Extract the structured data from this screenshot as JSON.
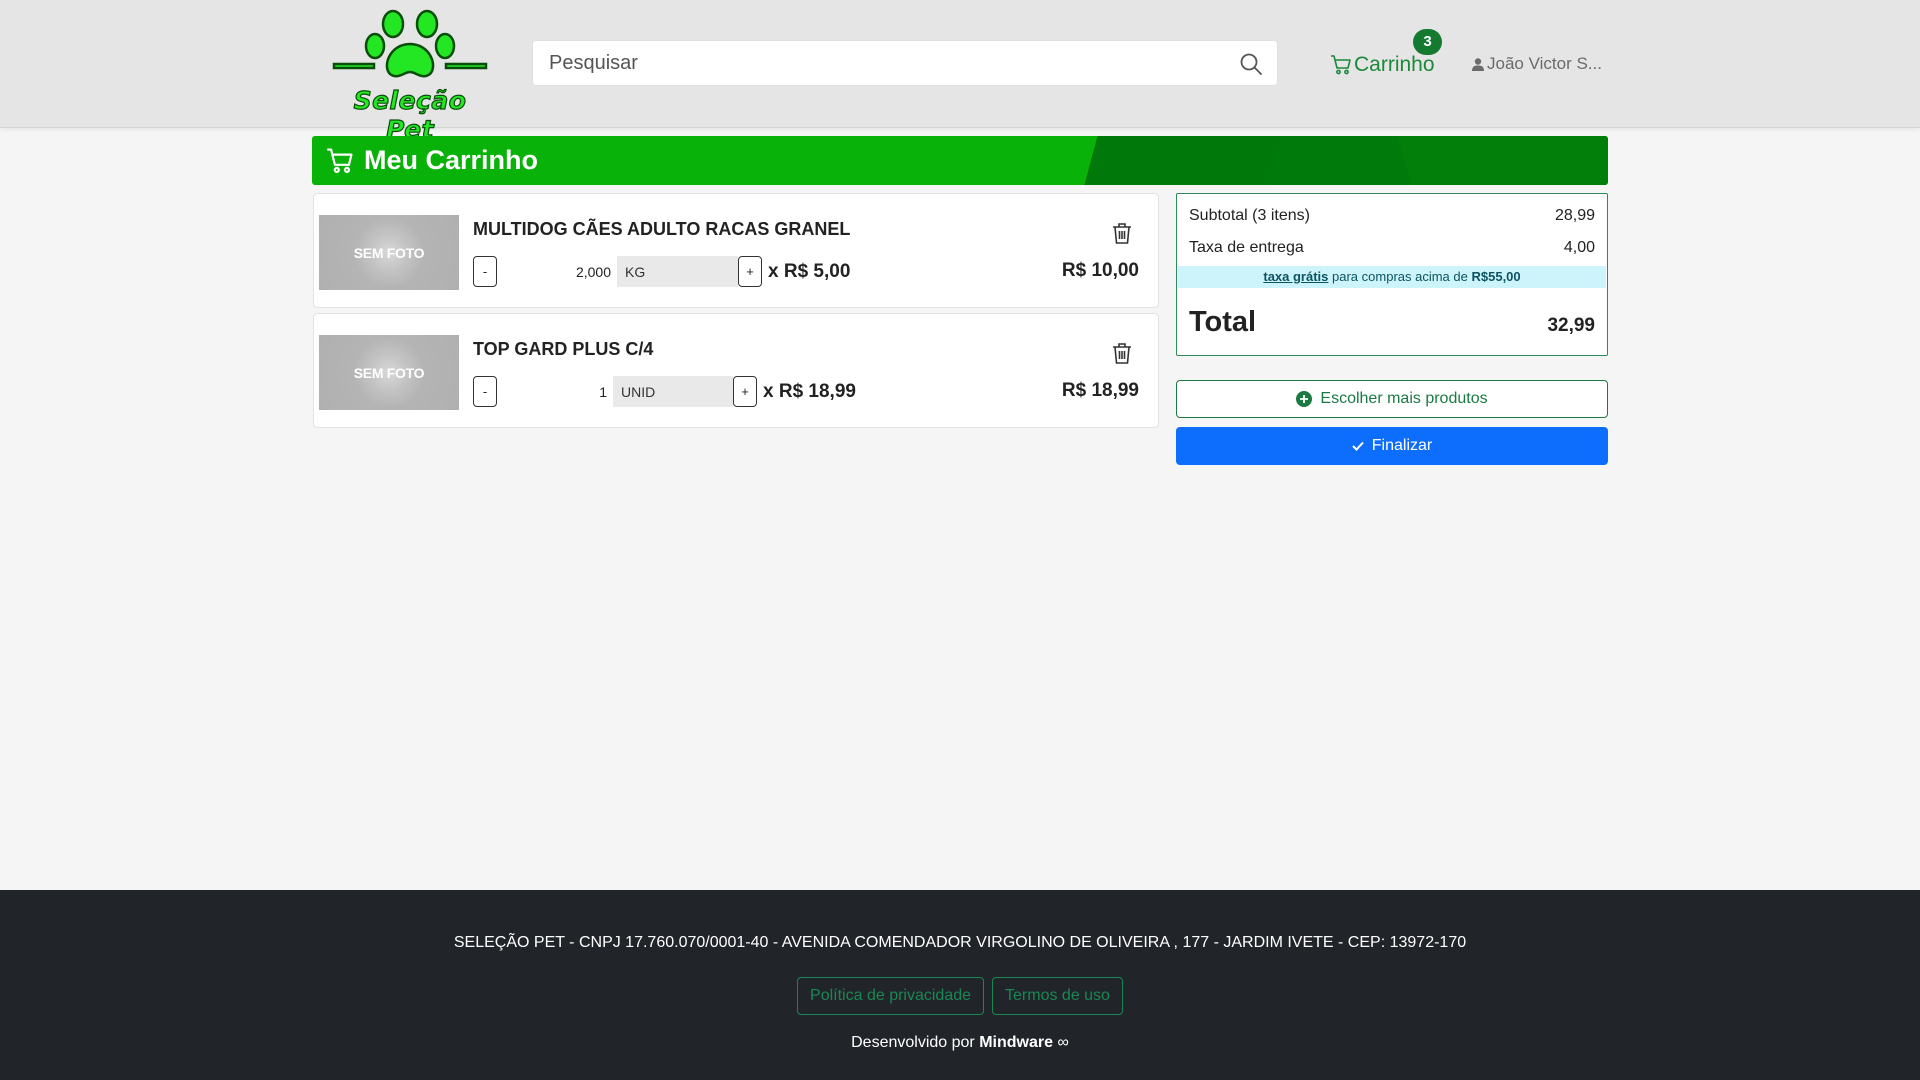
{
  "header": {
    "logo_text": "Seleção Pet",
    "search": {
      "placeholder": "Pesquisar",
      "value": ""
    },
    "cart": {
      "label": "Carrinho",
      "count": "3"
    },
    "user": {
      "name": "João Victor S..."
    }
  },
  "page_title": "Meu Carrinho",
  "items": [
    {
      "photo_label": "SEM FOTO",
      "name": "MULTIDOG CÃES ADULTO RACAS GRANEL",
      "minus": "-",
      "quantity": "2,000",
      "unit": "KG",
      "plus": "+",
      "unit_price": "x R$ 5,00",
      "total": "R$ 10,00"
    },
    {
      "photo_label": "SEM FOTO",
      "name": "TOP GARD PLUS C/4",
      "minus": "-",
      "quantity": "1",
      "unit": "UNID",
      "plus": "+",
      "unit_price": "x R$ 18,99",
      "total": "R$ 18,99"
    }
  ],
  "summary": {
    "subtotal_label": "Subtotal (3 itens)",
    "subtotal_value": "28,99",
    "delivery_label": "Taxa de entrega",
    "delivery_value": "4,00",
    "free_link": "taxa grátis",
    "free_text": " para compras acima de ",
    "free_amount": "R$55,00",
    "total_label": "Total",
    "total_value": "32,99"
  },
  "actions": {
    "more_label": "Escolher mais produtos",
    "finish_label": "Finalizar"
  },
  "footer": {
    "address": "SELEÇÃO PET - CNPJ 17.760.070/0001-40 - AVENIDA COMENDADOR VIRGOLINO DE OLIVEIRA , 177 - JARDIM IVETE - CEP: 13972-170",
    "privacy": "Política de privacidade",
    "terms": "Termos de uso",
    "dev_prefix": "Desenvolvido por ",
    "dev_brand": "Mindware",
    "dev_symbol": "∞"
  },
  "colors": {
    "brand_green": "#08b208",
    "brand_dark_green": "#017f0a",
    "cart_green": "#1b8a3a",
    "primary_blue": "#0d6efd",
    "footer_bg": "#212529",
    "info_bg": "#cdf3fb"
  },
  "icons": {
    "logo": "paw-icon",
    "search": "search-icon",
    "cart": "cart-icon",
    "user": "person-icon",
    "delete": "trash-icon",
    "add": "plus-circle-icon",
    "confirm": "check-icon"
  }
}
